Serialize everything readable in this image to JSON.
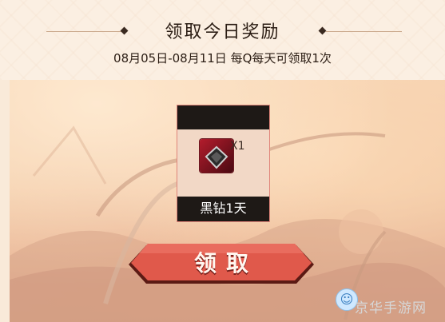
{
  "header": {
    "title": "领取今日奖励",
    "date_range": "08月05日-08月11日 每Q每天可领取1次"
  },
  "reward": {
    "item_name": "黑钻1天",
    "quantity": "X1",
    "icon": "black-diamond-icon"
  },
  "claim_button": {
    "label": "领取",
    "color": "#e0594b"
  },
  "watermark": {
    "text": "京华手游网"
  }
}
